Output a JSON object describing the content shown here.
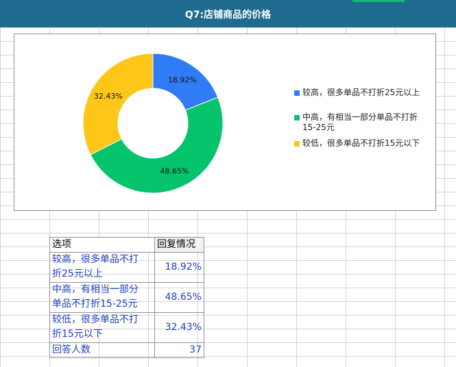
{
  "header": {
    "title": "Q7:店铺商品的价格",
    "bg_color": "#1f6b8f",
    "accent_color": "#18b96b"
  },
  "chart_data": {
    "type": "pie",
    "donut": true,
    "categories": [
      "较高，很多单品不打折25元以上",
      "中高，有相当一部分单品不打折15-25元",
      "较低，很多单品不打折15元以下"
    ],
    "values": [
      18.92,
      48.65,
      32.43
    ],
    "labels": [
      "18.92%",
      "48.65%",
      "32.43%"
    ],
    "colors": [
      "#2f7cf6",
      "#05c46b",
      "#ffc61a"
    ],
    "legend": "right"
  },
  "legend": [
    {
      "line1": "较高，很多单品不打折25元以上",
      "line2": ""
    },
    {
      "line1": "中高，有相当一部分单品不打折",
      "line2": "15-25元"
    },
    {
      "line1": "较低，很多单品不打折15元以下",
      "line2": ""
    }
  ],
  "table": {
    "headers": [
      "选项",
      "回复情况"
    ],
    "rows": [
      {
        "option_line1": "较高，很多单品不打",
        "option_line2": "折25元以上",
        "value": "18.92%"
      },
      {
        "option_line1": "中高，有相当一部分",
        "option_line2": "单品不打折15-25元",
        "value": "48.65%"
      },
      {
        "option_line1": "较低，很多单品不打",
        "option_line2": "折15元以下",
        "value": "32.43%"
      }
    ],
    "total_label": "回答人数",
    "total_value": "37"
  }
}
